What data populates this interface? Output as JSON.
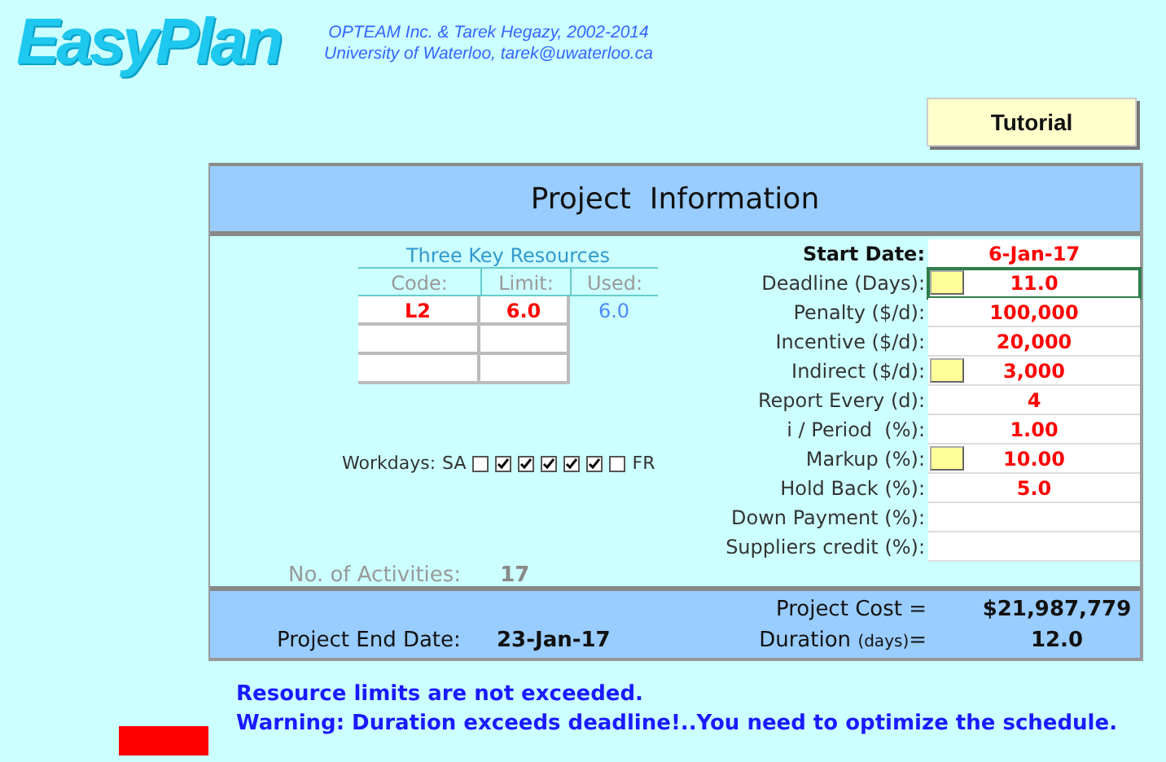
{
  "header": {
    "logo": "EasyPlan",
    "credits": "OPTEAM Inc. & Tarek Hegazy, 2002-2014 University of Waterloo, tarek@uwaterloo.ca",
    "tutorial_button": "Tutorial"
  },
  "panel": {
    "title": "Project  Information",
    "resources": {
      "title": "Three Key Resources",
      "columns": [
        "Code:",
        "Limit:",
        "Used:"
      ],
      "rows": [
        {
          "code": "L2",
          "limit": "6.0",
          "used": "6.0"
        },
        {},
        {}
      ]
    },
    "workdays": {
      "label": "Workdays:",
      "first_day": "SA",
      "last_day": "FR",
      "days": [
        {
          "checked": false
        },
        {
          "checked": true
        },
        {
          "checked": true
        },
        {
          "checked": true
        },
        {
          "checked": true
        },
        {
          "checked": true
        },
        {
          "checked": false
        }
      ]
    },
    "activities": {
      "label": "No. of Activities:",
      "value": "17"
    },
    "fields": [
      {
        "kind": "heading",
        "label": "Start Date:",
        "value": "6-Jan-17"
      },
      {
        "kind": "button",
        "label": "Deadline (Days):",
        "value": "11.0",
        "selected": true
      },
      {
        "kind": "plain",
        "label": "Penalty ($/d):",
        "value": "100,000"
      },
      {
        "kind": "plain",
        "label": "Incentive ($/d):",
        "value": "20,000"
      },
      {
        "kind": "button",
        "label": "Indirect ($/d):",
        "value": "3,000",
        "selected": false
      },
      {
        "kind": "plain",
        "label": "Report Every (d):",
        "value": "4"
      },
      {
        "kind": "plain",
        "label": "i / Period  (%):",
        "value": "1.00"
      },
      {
        "kind": "button",
        "label": "Markup (%):",
        "value": "10.00",
        "selected": false
      },
      {
        "kind": "plain",
        "label": "Hold Back (%):",
        "value": "5.0"
      },
      {
        "kind": "plain",
        "label": "Down Payment (%):"
      },
      {
        "kind": "plain",
        "label": "Suppliers credit (%):"
      }
    ],
    "summary": {
      "cost_label": "Project Cost =",
      "cost": "$21,987,779",
      "end_label": "Project End Date:",
      "end_date": "23-Jan-17",
      "duration_label": "Duration",
      "duration_unit": "(days)",
      "duration_suffix": "=",
      "duration": "12.0"
    }
  },
  "messages": [
    "Resource limits are not exceeded.",
    "Warning:  Duration exceeds deadline!..You need to optimize the schedule."
  ],
  "warning_flag": true
}
